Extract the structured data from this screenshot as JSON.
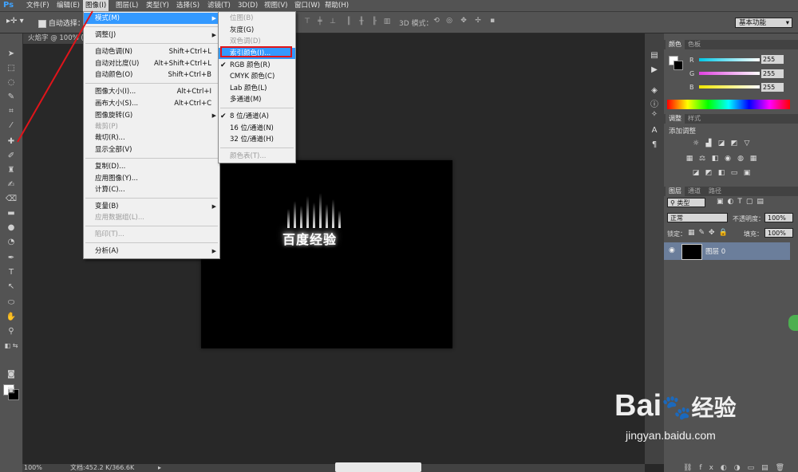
{
  "menubar": {
    "logo": "Ps",
    "items": [
      "文件(F)",
      "编辑(E)",
      "图像(I)",
      "图层(L)",
      "类型(Y)",
      "选择(S)",
      "滤镜(T)",
      "3D(D)",
      "视图(V)",
      "窗口(W)",
      "帮助(H)"
    ]
  },
  "options": {
    "auto_select": "自动选择：",
    "mode3d": "3D 模式：",
    "workspace": "基本功能"
  },
  "document": {
    "tab": "火焰字 @ 100% (图",
    "canvas_text": "百度经验"
  },
  "status": {
    "zoom": "100%",
    "doc_info": "文档:452.2 K/366.6K"
  },
  "image_menu": {
    "items": [
      {
        "label": "模式(M)",
        "shortcut": "",
        "submenu": true,
        "highlight": true
      },
      {
        "label": "调整(J)",
        "shortcut": "",
        "submenu": true
      },
      {
        "label": "自动色调(N)",
        "shortcut": "Shift+Ctrl+L"
      },
      {
        "label": "自动对比度(U)",
        "shortcut": "Alt+Shift+Ctrl+L"
      },
      {
        "label": "自动颜色(O)",
        "shortcut": "Shift+Ctrl+B"
      },
      {
        "label": "图像大小(I)...",
        "shortcut": "Alt+Ctrl+I"
      },
      {
        "label": "画布大小(S)...",
        "shortcut": "Alt+Ctrl+C"
      },
      {
        "label": "图像旋转(G)",
        "shortcut": "",
        "submenu": true
      },
      {
        "label": "裁剪(P)",
        "shortcut": "",
        "disabled": true
      },
      {
        "label": "裁切(R)...",
        "shortcut": ""
      },
      {
        "label": "显示全部(V)",
        "shortcut": ""
      },
      {
        "label": "复制(D)...",
        "shortcut": ""
      },
      {
        "label": "应用图像(Y)...",
        "shortcut": ""
      },
      {
        "label": "计算(C)...",
        "shortcut": ""
      },
      {
        "label": "变量(B)",
        "shortcut": "",
        "submenu": true
      },
      {
        "label": "应用数据组(L)...",
        "shortcut": "",
        "disabled": true
      },
      {
        "label": "陷印(T)...",
        "shortcut": "",
        "disabled": true
      },
      {
        "label": "分析(A)",
        "shortcut": "",
        "submenu": true
      }
    ]
  },
  "mode_menu": {
    "items": [
      {
        "label": "位图(B)",
        "disabled": true
      },
      {
        "label": "灰度(G)"
      },
      {
        "label": "双色调(D)",
        "disabled": true
      },
      {
        "label": "索引颜色(I)...",
        "highlight": true
      },
      {
        "label": "RGB 颜色(R)",
        "checked": true
      },
      {
        "label": "CMYK 颜色(C)"
      },
      {
        "label": "Lab 颜色(L)"
      },
      {
        "label": "多通道(M)"
      },
      {
        "label": "8 位/通道(A)",
        "checked": true
      },
      {
        "label": "16 位/通道(N)"
      },
      {
        "label": "32 位/通道(H)"
      },
      {
        "label": "颜色表(T)...",
        "disabled": true
      }
    ]
  },
  "color_panel": {
    "tabs": [
      "颜色",
      "色板"
    ],
    "r_label": "R",
    "g_label": "G",
    "b_label": "B",
    "r": "255",
    "g": "255",
    "b": "255",
    "colors": {
      "r_bar": "#00c8e6",
      "g_bar": "#e040e0",
      "b_bar": "#f0e600"
    }
  },
  "adjust_panel": {
    "tabs": [
      "调整",
      "样式"
    ],
    "title": "添加调整"
  },
  "layers_panel": {
    "tabs": [
      "图层",
      "通道",
      "路径"
    ],
    "filter": "类型",
    "blend": "正常",
    "opacity_label": "不透明度：",
    "opacity": "100%",
    "lock_label": "锁定：",
    "fill_label": "填充：",
    "fill": "100%",
    "layer_name": "图层 0"
  },
  "watermark": {
    "logo": "Bai",
    "logo2": "经验",
    "url": "jingyan.baidu.com"
  },
  "colors": {
    "accent": "#3399ff",
    "annotation": "#e0141a"
  }
}
